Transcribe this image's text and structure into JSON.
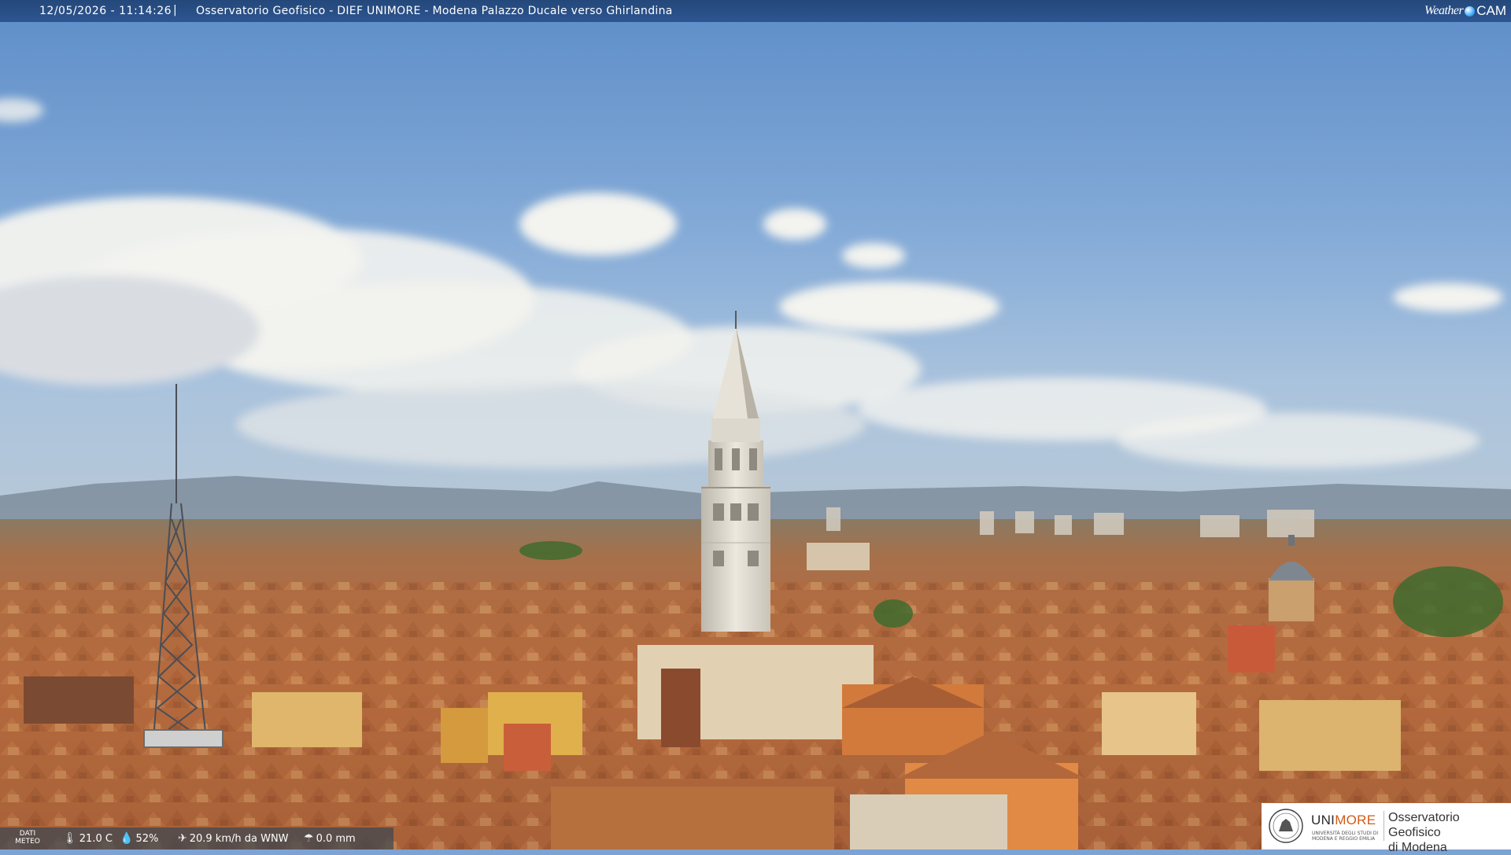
{
  "header": {
    "timestamp": "12/05/2026 - 11:14:26",
    "separator": "|",
    "title": "Osservatorio Geofisico - DIEF UNIMORE - Modena Palazzo Ducale verso Ghirlandina",
    "brand_left": "Weather",
    "brand_right": "CAM"
  },
  "weather": {
    "label": "DATI METEO",
    "temperature": "21.0 C",
    "humidity": "52%",
    "wind": "20.9 km/h da WNW",
    "rain": "0.0 mm",
    "icons": [
      "thermometer-icon",
      "humidity-icon",
      "wind-icon",
      "rain-icon"
    ]
  },
  "logo": {
    "uni_main": "UNI",
    "uni_accent": "MORE",
    "uni_sub": "UNIVERSITÀ DEGLI STUDI DI MODENA E REGGIO EMILIA",
    "obs_line1": "Osservatorio Geofisico",
    "obs_line2": "di Modena"
  },
  "colors": {
    "header_bar": "#2d5591",
    "sky_top": "#5f8fc9",
    "roof_terracotta": "#b56a3c",
    "unimore_accent": "#d05a1a"
  }
}
